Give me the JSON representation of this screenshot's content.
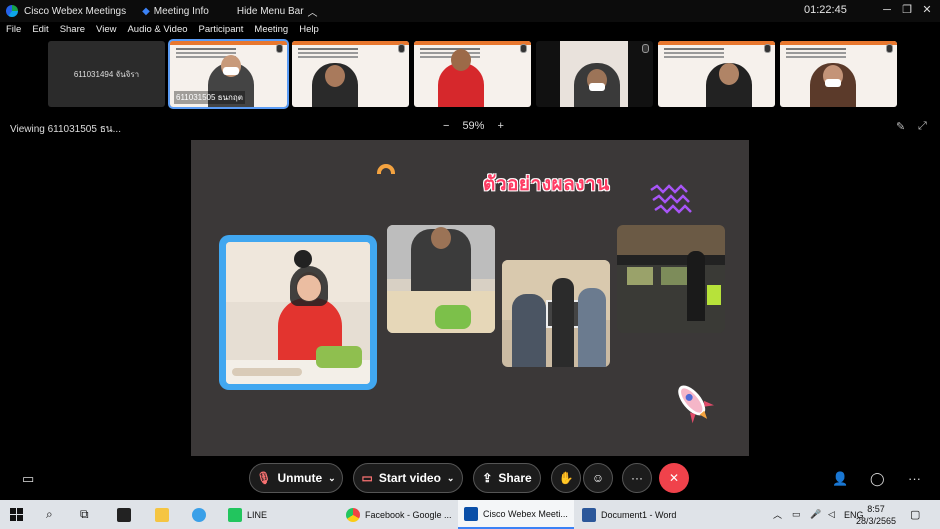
{
  "titlebar": {
    "app_name": "Cisco Webex Meetings",
    "meeting_info": "Meeting Info",
    "hide_menu_bar": "Hide Menu Bar",
    "timer": "01:22:45"
  },
  "menu": [
    "File",
    "Edit",
    "Share",
    "View",
    "Audio & Video",
    "Participant",
    "Meeting",
    "Help"
  ],
  "participants": {
    "name_only": "611031494 จันจิรา",
    "active_label": "611031505 ธนกฤต"
  },
  "viewing": {
    "label": "Viewing 611031505 ธน...",
    "zoom_minus": "−",
    "zoom_level": "59%",
    "zoom_plus": "+"
  },
  "slide": {
    "title": "ตัวอย่างผลงาน",
    "accent": "#ff3b63"
  },
  "controls": {
    "unmute": "Unmute",
    "start_video": "Start video",
    "share": "Share",
    "more": "···"
  },
  "taskbar": {
    "line": "LINE",
    "chrome": "Facebook - Google ...",
    "webex": "Cisco Webex Meeti...",
    "word": "Document1 - Word",
    "lang": "ENG",
    "time": "8:57",
    "date": "28/3/2565"
  }
}
